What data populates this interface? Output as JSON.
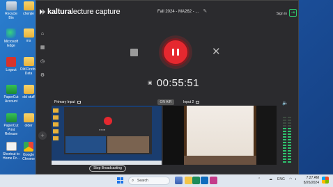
{
  "desktop": {
    "icons": [
      {
        "label": "Recycle Bin",
        "kind": "bin"
      },
      {
        "label": "chenjie",
        "kind": "folder"
      },
      {
        "label": "Microsoft Edge",
        "kind": "edge"
      },
      {
        "label": "ms",
        "kind": "folder"
      },
      {
        "label": "Logout",
        "kind": "logout"
      },
      {
        "label": "Old Firefox Data",
        "kind": "folder"
      },
      {
        "label": "PaperCut Account",
        "kind": "green"
      },
      {
        "label": "old stuff",
        "kind": "folder"
      },
      {
        "label": "PaperCut Print Release",
        "kind": "green"
      },
      {
        "label": "older",
        "kind": "folder"
      },
      {
        "label": "Shortcut to Home Dr...",
        "kind": "doc"
      },
      {
        "label": "Google Chrome",
        "kind": "chrome"
      }
    ]
  },
  "app": {
    "logo_text_bold": "kaltura",
    "logo_text": "lecture capture",
    "session_title": "Fall 2024 - MA262 - ...",
    "signin_label": "Sign in",
    "signin_icon": "sign-in-icon",
    "timer": "00:55:51",
    "primary_input_label": "Primary Input",
    "input2_label": "Input 2",
    "on_air_label": "ON AIR",
    "stop_broadcasting_label": "Stop Broadcasting",
    "audio_level": 0.75,
    "accent_color": "#e5282f",
    "meter_color": "#2ec56e"
  },
  "taskbar": {
    "search_placeholder": "Search",
    "language": "ENG",
    "time": "7:27 AM",
    "date": "8/26/2024"
  }
}
